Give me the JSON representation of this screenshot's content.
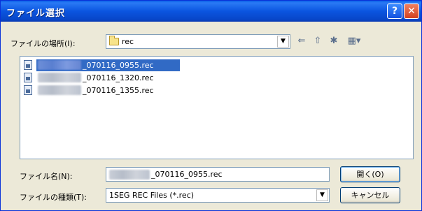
{
  "window": {
    "title": "ファイル選択",
    "help_glyph": "?",
    "close_glyph": "✕"
  },
  "location": {
    "label": "ファイルの場所(I):",
    "value": "rec",
    "dropdown_glyph": "▼"
  },
  "toolbar": {
    "back_glyph": "⇐",
    "up_glyph": "⇧",
    "newfolder_glyph": "✱",
    "view_glyph": "▦▾"
  },
  "files": [
    {
      "name": "_070116_0955.rec",
      "selected": true
    },
    {
      "name": "_070116_1320.rec",
      "selected": false
    },
    {
      "name": "_070116_1355.rec",
      "selected": false
    }
  ],
  "filename": {
    "label": "ファイル名(N):",
    "value": "_070116_0955.rec"
  },
  "filetype": {
    "label": "ファイルの種類(T):",
    "value": "1SEG REC Files (*.rec)",
    "dropdown_glyph": "▼"
  },
  "buttons": {
    "open": "開く(O)",
    "cancel": "キャンセル"
  }
}
